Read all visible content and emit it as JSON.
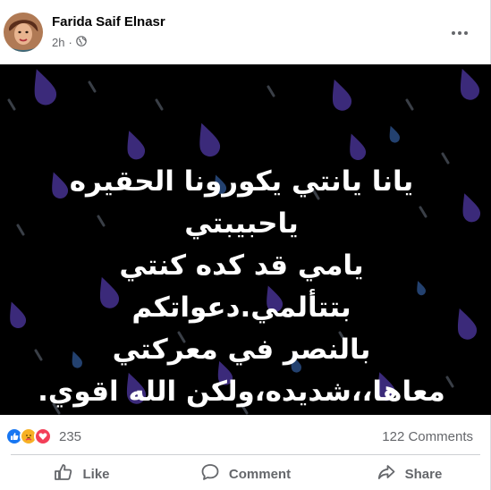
{
  "post": {
    "author": "Farida Saif Elnasr",
    "time": "2h",
    "lines": [
      "يانا يانتي يكورونا الحقيره ياحبيبتي",
      "يامي قد كده كنتي بتتألمي.دعواتكم",
      "بالنصر في معركتي",
      "معاها،،شديده،ولكن الله اقوي."
    ]
  },
  "stats": {
    "reactions_count": "235",
    "comments_count": "122 Comments",
    "reaction_icons": [
      "like-icon",
      "care-icon",
      "love-icon"
    ]
  },
  "actions": {
    "like_label": "Like",
    "comment_label": "Comment",
    "share_label": "Share"
  },
  "colors": {
    "like_blue": "#1877f2",
    "love_red": "#f33e58",
    "care_yellow": "#f7b125",
    "text_secondary": "#65676b",
    "raindrop_purple": "#3b2a7a"
  }
}
